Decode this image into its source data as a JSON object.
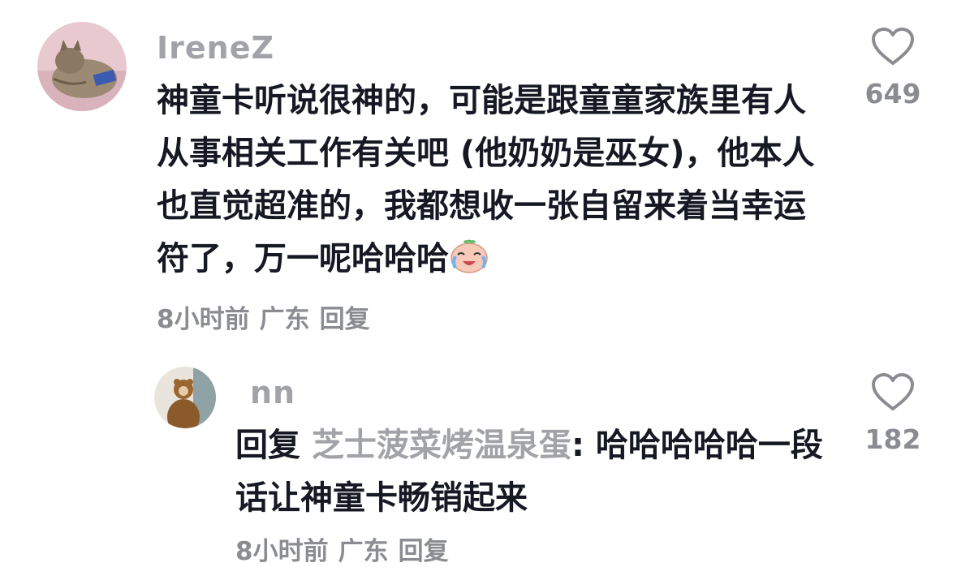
{
  "comments": [
    {
      "username": "IreneZ",
      "text": "神童卡听说很神的，可能是跟童童家族里有人从事相关工作有关吧 (他奶奶是巫女)，他本人也直觉超准的，我都想收一张自留来着当幸运符了，万一呢哈哈哈",
      "emoji": "crying-laughing-emoji",
      "time": "8小时前",
      "location": "广东",
      "reply_label": "回复",
      "likes": "649",
      "icon": "heart-icon"
    },
    {
      "username": "nn",
      "reply_prefix": "回复",
      "reply_target": "芝士菠菜烤温泉蛋",
      "text": ": 哈哈哈哈哈一段话让神童卡畅销起来",
      "time": "8小时前",
      "location": "广东",
      "reply_label": "回复",
      "likes": "182",
      "icon": "heart-icon"
    }
  ]
}
